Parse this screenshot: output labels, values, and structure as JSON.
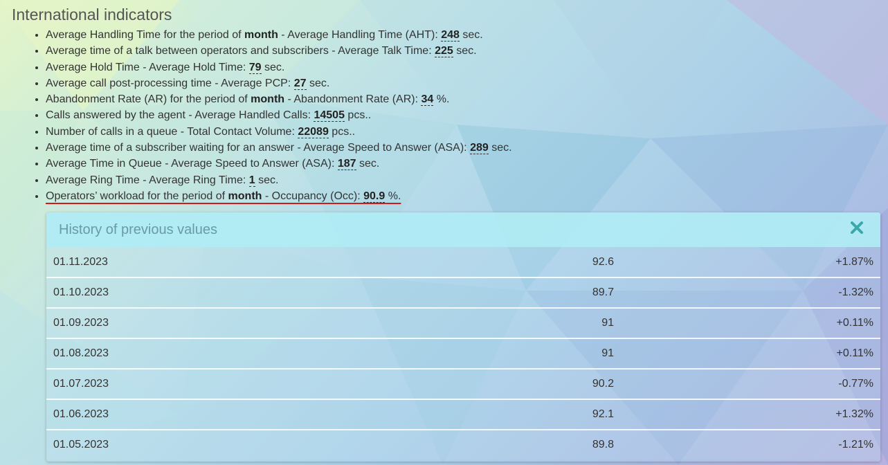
{
  "section": {
    "title": "International indicators"
  },
  "indicators": [
    {
      "prefix": "Average Handling Time for the period of ",
      "bold": "month",
      "middle": " - Average Handling Time (AHT): ",
      "value": "248",
      "unit": " sec."
    },
    {
      "prefix": "Average time of a talk between operators and subscribers - Average Talk Time: ",
      "bold": "",
      "middle": "",
      "value": "225",
      "unit": " sec."
    },
    {
      "prefix": "Average Hold Time - Average Hold Time: ",
      "bold": "",
      "middle": "",
      "value": "79",
      "unit": " sec."
    },
    {
      "prefix": "Average call post-processing time - Average PCP: ",
      "bold": "",
      "middle": "",
      "value": "27",
      "unit": " sec."
    },
    {
      "prefix": "Abandonment Rate (AR) for the period of ",
      "bold": "month",
      "middle": " - Abandonment Rate (AR): ",
      "value": "34",
      "unit": " %."
    },
    {
      "prefix": "Calls answered by the agent - Average Handled Calls: ",
      "bold": "",
      "middle": "",
      "value": "14505",
      "unit": " pcs.."
    },
    {
      "prefix": "Number of calls in a queue - Total Contact Volume: ",
      "bold": "",
      "middle": "",
      "value": "22089",
      "unit": " pcs.."
    },
    {
      "prefix": "Average time of a subscriber waiting for an answer - Average Speed to Answer (ASA): ",
      "bold": "",
      "middle": "",
      "value": "289",
      "unit": " sec."
    },
    {
      "prefix": "Average Time in Queue - Average Speed to Answer (ASA): ",
      "bold": "",
      "middle": "",
      "value": "187",
      "unit": " sec."
    },
    {
      "prefix": "Average Ring Time - Average Ring Time: ",
      "bold": "",
      "middle": "",
      "value": "1",
      "unit": " sec."
    },
    {
      "prefix": "Operators’ workload for the period of ",
      "bold": "month",
      "middle": " - Occupancy (Occ): ",
      "value": "90.9",
      "unit": " %."
    }
  ],
  "history": {
    "title": "History of previous values",
    "close_icon": "close-x-icon",
    "rows": [
      {
        "date": "01.11.2023",
        "value": "92.6",
        "diff": "+1.87%"
      },
      {
        "date": "01.10.2023",
        "value": "89.7",
        "diff": "-1.32%"
      },
      {
        "date": "01.09.2023",
        "value": "91",
        "diff": "+0.11%"
      },
      {
        "date": "01.08.2023",
        "value": "91",
        "diff": "+0.11%"
      },
      {
        "date": "01.07.2023",
        "value": "90.2",
        "diff": "-0.77%"
      },
      {
        "date": "01.06.2023",
        "value": "92.1",
        "diff": "+1.32%"
      },
      {
        "date": "01.05.2023",
        "value": "89.8",
        "diff": "-1.21%"
      }
    ]
  },
  "colors": {
    "accent_close": "#3aa7a8",
    "history_header_bg": "#b0ecf4",
    "history_title": "#6a9aa8",
    "highlight_underline": "#d21818"
  }
}
